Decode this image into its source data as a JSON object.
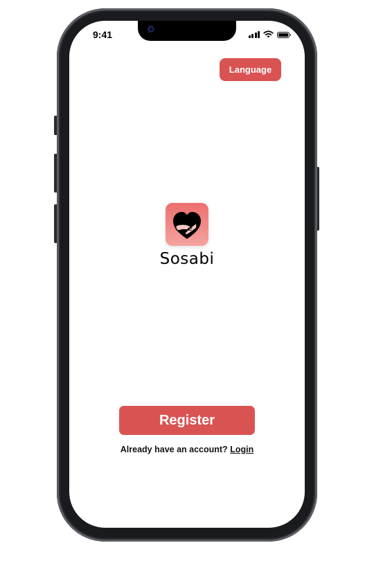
{
  "status_bar": {
    "time": "9:41",
    "icons": [
      "cellular-signal-icon",
      "wifi-icon",
      "battery-icon"
    ]
  },
  "header": {
    "language_button_label": "Language"
  },
  "brand": {
    "logo_icon": "hugging-heart-logo-icon",
    "app_name": "Sosabi"
  },
  "actions": {
    "register_label": "Register",
    "login_prompt": "Already have an account?",
    "login_link": "Login"
  },
  "colors": {
    "accent": "#d95353",
    "logo_gradient_top": "#ed6f6d",
    "logo_gradient_bottom": "#f4a3a0",
    "text": "#111111",
    "background": "#ffffff"
  }
}
